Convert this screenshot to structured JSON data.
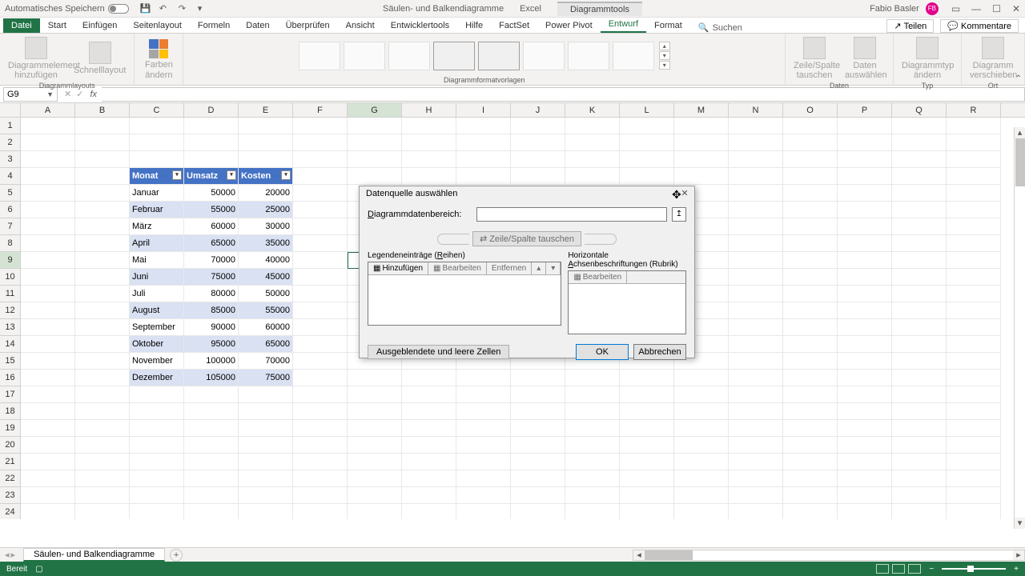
{
  "title_bar": {
    "autosave_label": "Automatisches Speichern",
    "doc_name": "Säulen- und Balkendiagramme",
    "app_name": "Excel",
    "context_tab": "Diagrammtools",
    "user_name": "Fabio Basler",
    "user_initials": "FB"
  },
  "tabs": {
    "file": "Datei",
    "home": "Start",
    "insert": "Einfügen",
    "page_layout": "Seitenlayout",
    "formulas": "Formeln",
    "data": "Daten",
    "review": "Überprüfen",
    "view": "Ansicht",
    "developer": "Entwicklertools",
    "help": "Hilfe",
    "factset": "FactSet",
    "power_pivot": "Power Pivot",
    "design": "Entwurf",
    "format": "Format",
    "search_label": "Suchen",
    "share": "Teilen",
    "comments": "Kommentare"
  },
  "ribbon": {
    "add_element": "Diagrammelement hinzufügen",
    "quick_layout": "Schnelllayout",
    "change_colors": "Farben ändern",
    "group_layouts": "Diagrammlayouts",
    "group_styles": "Diagrammformatvorlagen",
    "switch_rowcol": "Zeile/Spalte tauschen",
    "select_data": "Daten auswählen",
    "group_data": "Daten",
    "change_type": "Diagrammtyp ändern",
    "group_type": "Typ",
    "move_chart": "Diagramm verschieben",
    "group_location": "Ort"
  },
  "namebox": {
    "ref": "G9"
  },
  "columns": [
    "A",
    "B",
    "C",
    "D",
    "E",
    "F",
    "G",
    "H",
    "I",
    "J",
    "K",
    "L",
    "M",
    "N",
    "O",
    "P",
    "Q",
    "R"
  ],
  "active_col": "G",
  "active_row": 9,
  "table": {
    "headers": [
      "Monat",
      "Umsatz",
      "Kosten"
    ],
    "rows": [
      [
        "Januar",
        "50000",
        "20000"
      ],
      [
        "Februar",
        "55000",
        "25000"
      ],
      [
        "März",
        "60000",
        "30000"
      ],
      [
        "April",
        "65000",
        "35000"
      ],
      [
        "Mai",
        "70000",
        "40000"
      ],
      [
        "Juni",
        "75000",
        "45000"
      ],
      [
        "Juli",
        "80000",
        "50000"
      ],
      [
        "August",
        "85000",
        "55000"
      ],
      [
        "September",
        "90000",
        "60000"
      ],
      [
        "Oktober",
        "95000",
        "65000"
      ],
      [
        "November",
        "100000",
        "70000"
      ],
      [
        "Dezember",
        "105000",
        "75000"
      ]
    ]
  },
  "dialog": {
    "title": "Datenquelle auswählen",
    "range_label": "Diagrammdatenbereich:",
    "switch_label": "Zeile/Spalte tauschen",
    "legend_label": "Legendeneinträge (Reihen)",
    "axis_label": "Horizontale Achsenbeschriftungen (Rubrik)",
    "add_btn": "Hinzufügen",
    "edit_btn": "Bearbeiten",
    "remove_btn": "Entfernen",
    "edit_btn2": "Bearbeiten",
    "hidden_cells": "Ausgeblendete und leere Zellen",
    "ok": "OK",
    "cancel": "Abbrechen"
  },
  "sheet": {
    "name": "Säulen- und Balkendiagramme"
  },
  "status": {
    "ready": "Bereit"
  }
}
